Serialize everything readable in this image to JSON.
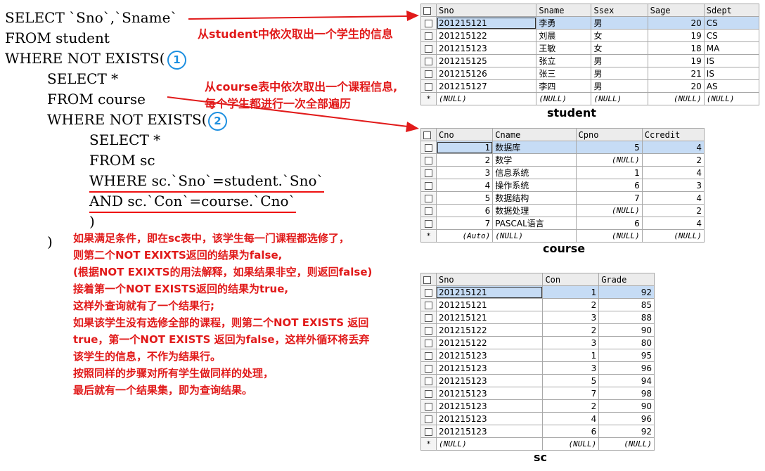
{
  "sql": {
    "line1": "SELECT `Sno`,`Sname`",
    "line2": "FROM student",
    "line3": "WHERE NOT EXISTS(",
    "line4": "SELECT *",
    "line5": "FROM course",
    "line6": "WHERE NOT EXISTS(",
    "line7": "SELECT *",
    "line8": "FROM sc",
    "line9": "WHERE sc.`Sno`=student.`Sno`",
    "line10": "AND sc.`Con`=course.`Cno`",
    "line11": ")",
    "line12": ")"
  },
  "markers": {
    "one": "1",
    "two": "2"
  },
  "annotations": {
    "student_note": "从student中依次取出一个学生的信息",
    "course_note_1": "从course表中依次取出一个课程信息,",
    "course_note_2": "每个学生都进行一次全部遍历",
    "explain": [
      "如果满足条件，即在sc表中，该学生每一门课程都选修了，",
      "则第二个NOT EXIXTS返回的结果为false,",
      "(根据NOT EXIXTS的用法解释，如果结果非空，则返回false)",
      "接着第一个NOT EXISTS返回的结果为true,",
      "这样外查询就有了一个结果行;",
      "如果该学生没有选修全部的课程，则第二个NOT EXISTS 返回",
      "true，第一个NOT EXISTS 返回为false，这样外循环将丢弃",
      "该学生的信息，不作为结果行。",
      "按照同样的步骤对所有学生做同样的处理，",
      "最后就有一个结果集，即为查询结果。"
    ]
  },
  "student_table": {
    "caption": "student",
    "columns": [
      "Sno",
      "Sname",
      "Ssex",
      "Sage",
      "Sdept"
    ],
    "rows": [
      [
        "201215121",
        "李勇",
        "男",
        "20",
        "CS"
      ],
      [
        "201215122",
        "刘晨",
        "女",
        "19",
        "CS"
      ],
      [
        "201215123",
        "王敏",
        "女",
        "18",
        "MA"
      ],
      [
        "201215125",
        "张立",
        "男",
        "19",
        "IS"
      ],
      [
        "201215126",
        "张三",
        "男",
        "21",
        "IS"
      ],
      [
        "201215127",
        "李四",
        "男",
        "20",
        "AS"
      ]
    ],
    "new_row": [
      "(NULL)",
      "(NULL)",
      "(NULL)",
      "(NULL)",
      "(NULL)"
    ]
  },
  "course_table": {
    "caption": "course",
    "columns": [
      "Cno",
      "Cname",
      "Cpno",
      "Ccredit"
    ],
    "rows": [
      [
        "1",
        "数据库",
        "5",
        "4"
      ],
      [
        "2",
        "数学",
        "(NULL)",
        "2"
      ],
      [
        "3",
        "信息系统",
        "1",
        "4"
      ],
      [
        "4",
        "操作系统",
        "6",
        "3"
      ],
      [
        "5",
        "数据结构",
        "7",
        "4"
      ],
      [
        "6",
        "数据处理",
        "(NULL)",
        "2"
      ],
      [
        "7",
        "PASCAL语言",
        "6",
        "4"
      ]
    ],
    "new_row": [
      "(Auto)",
      "(NULL)",
      "(NULL)",
      "(NULL)"
    ]
  },
  "sc_table": {
    "caption": "sc",
    "columns": [
      "Sno",
      "Con",
      "Grade"
    ],
    "rows": [
      [
        "201215121",
        "1",
        "92"
      ],
      [
        "201215121",
        "2",
        "85"
      ],
      [
        "201215121",
        "3",
        "88"
      ],
      [
        "201215122",
        "2",
        "90"
      ],
      [
        "201215122",
        "3",
        "80"
      ],
      [
        "201215123",
        "1",
        "95"
      ],
      [
        "201215123",
        "3",
        "96"
      ],
      [
        "201215123",
        "5",
        "94"
      ],
      [
        "201215123",
        "7",
        "98"
      ],
      [
        "201215123",
        "2",
        "90"
      ],
      [
        "201215123",
        "4",
        "96"
      ],
      [
        "201215123",
        "6",
        "92"
      ]
    ],
    "new_row": [
      "(NULL)",
      "(NULL)",
      "(NULL)"
    ]
  },
  "colors": {
    "annotation": "#e11a1a",
    "marker": "#1d8fe0",
    "highlight": "#c6dcf5"
  }
}
